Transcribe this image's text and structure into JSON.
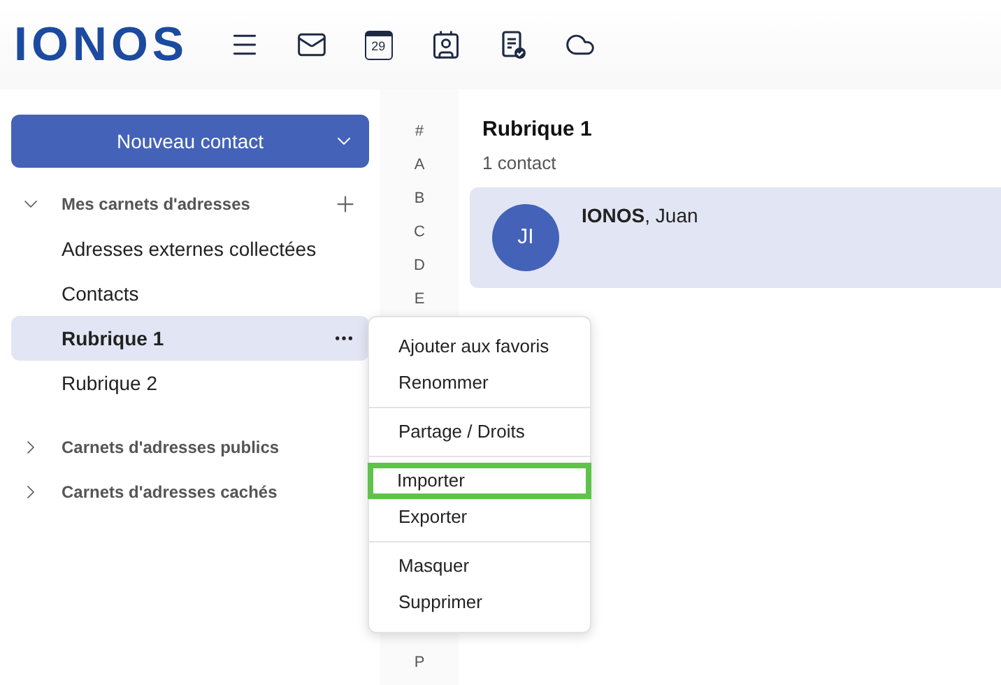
{
  "header": {
    "logo": "IONOS",
    "apps": [
      {
        "kind": "menu"
      },
      {
        "kind": "mail"
      },
      {
        "kind": "calendar",
        "day": "29"
      },
      {
        "kind": "contacts"
      },
      {
        "kind": "tasks"
      },
      {
        "kind": "cloud"
      }
    ]
  },
  "new_contact_button": {
    "label": "Nouveau contact"
  },
  "sidebar": {
    "sections": [
      {
        "title": "Mes carnets d'adresses",
        "expanded": true,
        "can_add": true,
        "items": [
          {
            "label": "Adresses externes collectées",
            "selected": false
          },
          {
            "label": "Contacts",
            "selected": false
          },
          {
            "label": "Rubrique 1",
            "selected": true
          },
          {
            "label": "Rubrique 2",
            "selected": false
          }
        ]
      },
      {
        "title": "Carnets d'adresses publics",
        "expanded": false,
        "can_add": false
      },
      {
        "title": "Carnets d'adresses cachés",
        "expanded": false,
        "can_add": false
      }
    ]
  },
  "alphabet": {
    "top": [
      "#",
      "A",
      "B",
      "C",
      "D",
      "E"
    ],
    "bottom": [
      "P"
    ]
  },
  "list": {
    "title": "Rubrique 1",
    "count": "1 contact",
    "contacts": [
      {
        "initials": "JI",
        "last_name": "IONOS",
        "first_name": ", Juan",
        "selected": true
      }
    ]
  },
  "context_menu": {
    "groups": [
      [
        {
          "label": "Ajouter aux favoris",
          "highlighted": false
        },
        {
          "label": "Renommer",
          "highlighted": false
        }
      ],
      [
        {
          "label": "Partage / Droits",
          "highlighted": false
        }
      ],
      [
        {
          "label": "Importer",
          "highlighted": true
        },
        {
          "label": "Exporter",
          "highlighted": false
        }
      ],
      [
        {
          "label": "Masquer",
          "highlighted": false
        },
        {
          "label": "Supprimer",
          "highlighted": false
        }
      ]
    ]
  }
}
